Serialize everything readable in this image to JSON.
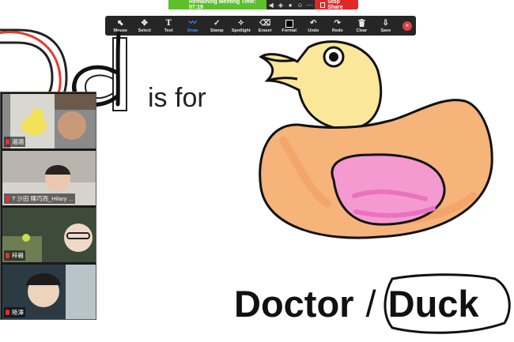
{
  "meeting_bar": {
    "time_text": "Remaining Meeting Time: 07:19",
    "stop_share_label": "Stop Share",
    "stop_icon": "stop-square-icon",
    "icons": [
      "speaker-icon",
      "shield-icon",
      "record-icon",
      "participants-icon",
      "more-icon"
    ]
  },
  "toolbar": {
    "tools": [
      {
        "label": "Mouse",
        "icon": "cursor-arrow-icon",
        "glyph": "⬉"
      },
      {
        "label": "Select",
        "icon": "move-arrows-icon",
        "glyph": "✥"
      },
      {
        "label": "Text",
        "icon": "text-t-icon",
        "glyph": "T"
      },
      {
        "label": "Draw",
        "icon": "pen-line-icon",
        "glyph": "〰"
      },
      {
        "label": "Stamp",
        "icon": "checkmark-stamp-icon",
        "glyph": "✓"
      },
      {
        "label": "Spotlight",
        "icon": "spotlight-wand-icon",
        "glyph": "✧"
      },
      {
        "label": "Eraser",
        "icon": "eraser-icon",
        "glyph": "⌫"
      },
      {
        "label": "Format",
        "icon": "format-swatch-icon",
        "glyph": ""
      },
      {
        "label": "Undo",
        "icon": "undo-icon",
        "glyph": "↶"
      },
      {
        "label": "Redo",
        "icon": "redo-icon",
        "glyph": "↷"
      },
      {
        "label": "Clear",
        "icon": "trash-icon",
        "glyph": "🗑"
      },
      {
        "label": "Save",
        "icon": "save-download-icon",
        "glyph": "⇩"
      }
    ],
    "close_glyph": "×"
  },
  "slide": {
    "is_for": "is for",
    "word_doctor": "Doctor",
    "slash": "/",
    "word_duck": "Duck"
  },
  "participants": [
    {
      "name": "湘湘"
    },
    {
      "name": "T 沙田 陳巧而_Hilary ..."
    },
    {
      "name": "梓雞"
    },
    {
      "name": "睦澤"
    }
  ],
  "colors": {
    "accent_active": "#3a9cff",
    "meeting_green": "#5fbe2d",
    "stop_red": "#e02828",
    "duck_body": "#f6b37a",
    "duck_head": "#fbe79a",
    "duck_wing": "#f59ad0"
  }
}
